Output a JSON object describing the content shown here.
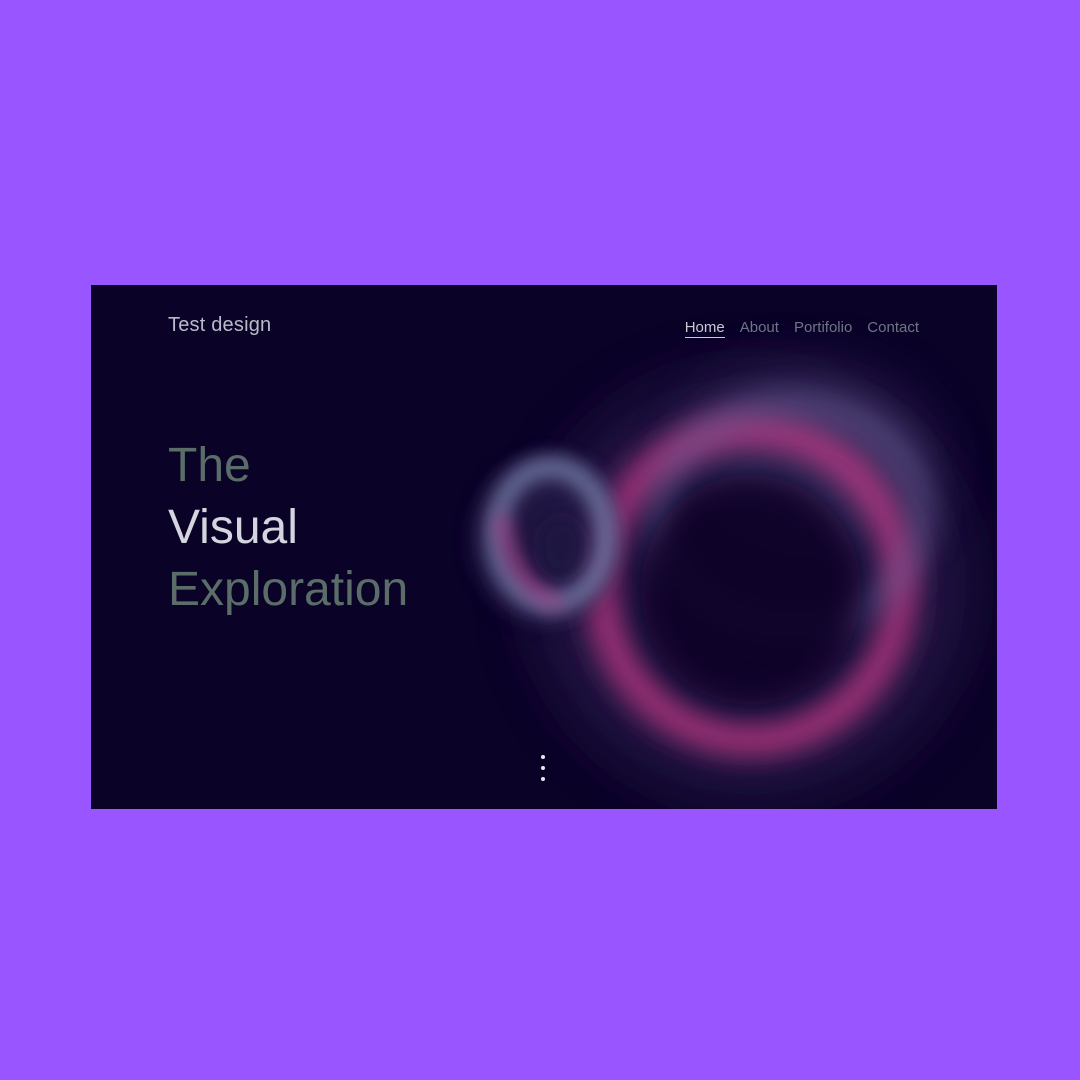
{
  "header": {
    "brand": "Test design",
    "nav": [
      {
        "label": "Home",
        "active": true
      },
      {
        "label": "About",
        "active": false
      },
      {
        "label": "Portifolio",
        "active": false
      },
      {
        "label": "Contact",
        "active": false
      }
    ]
  },
  "hero": {
    "line1": "The",
    "line2": "Visual",
    "line3": "Exploration"
  },
  "scroll_indicator": {
    "icon": "vertical-dots-icon"
  },
  "colors": {
    "outer_background": "#9955ff",
    "screen_background": "#0b0228",
    "accent_pink": "#d03c8c",
    "accent_blue": "#7b86b8"
  }
}
